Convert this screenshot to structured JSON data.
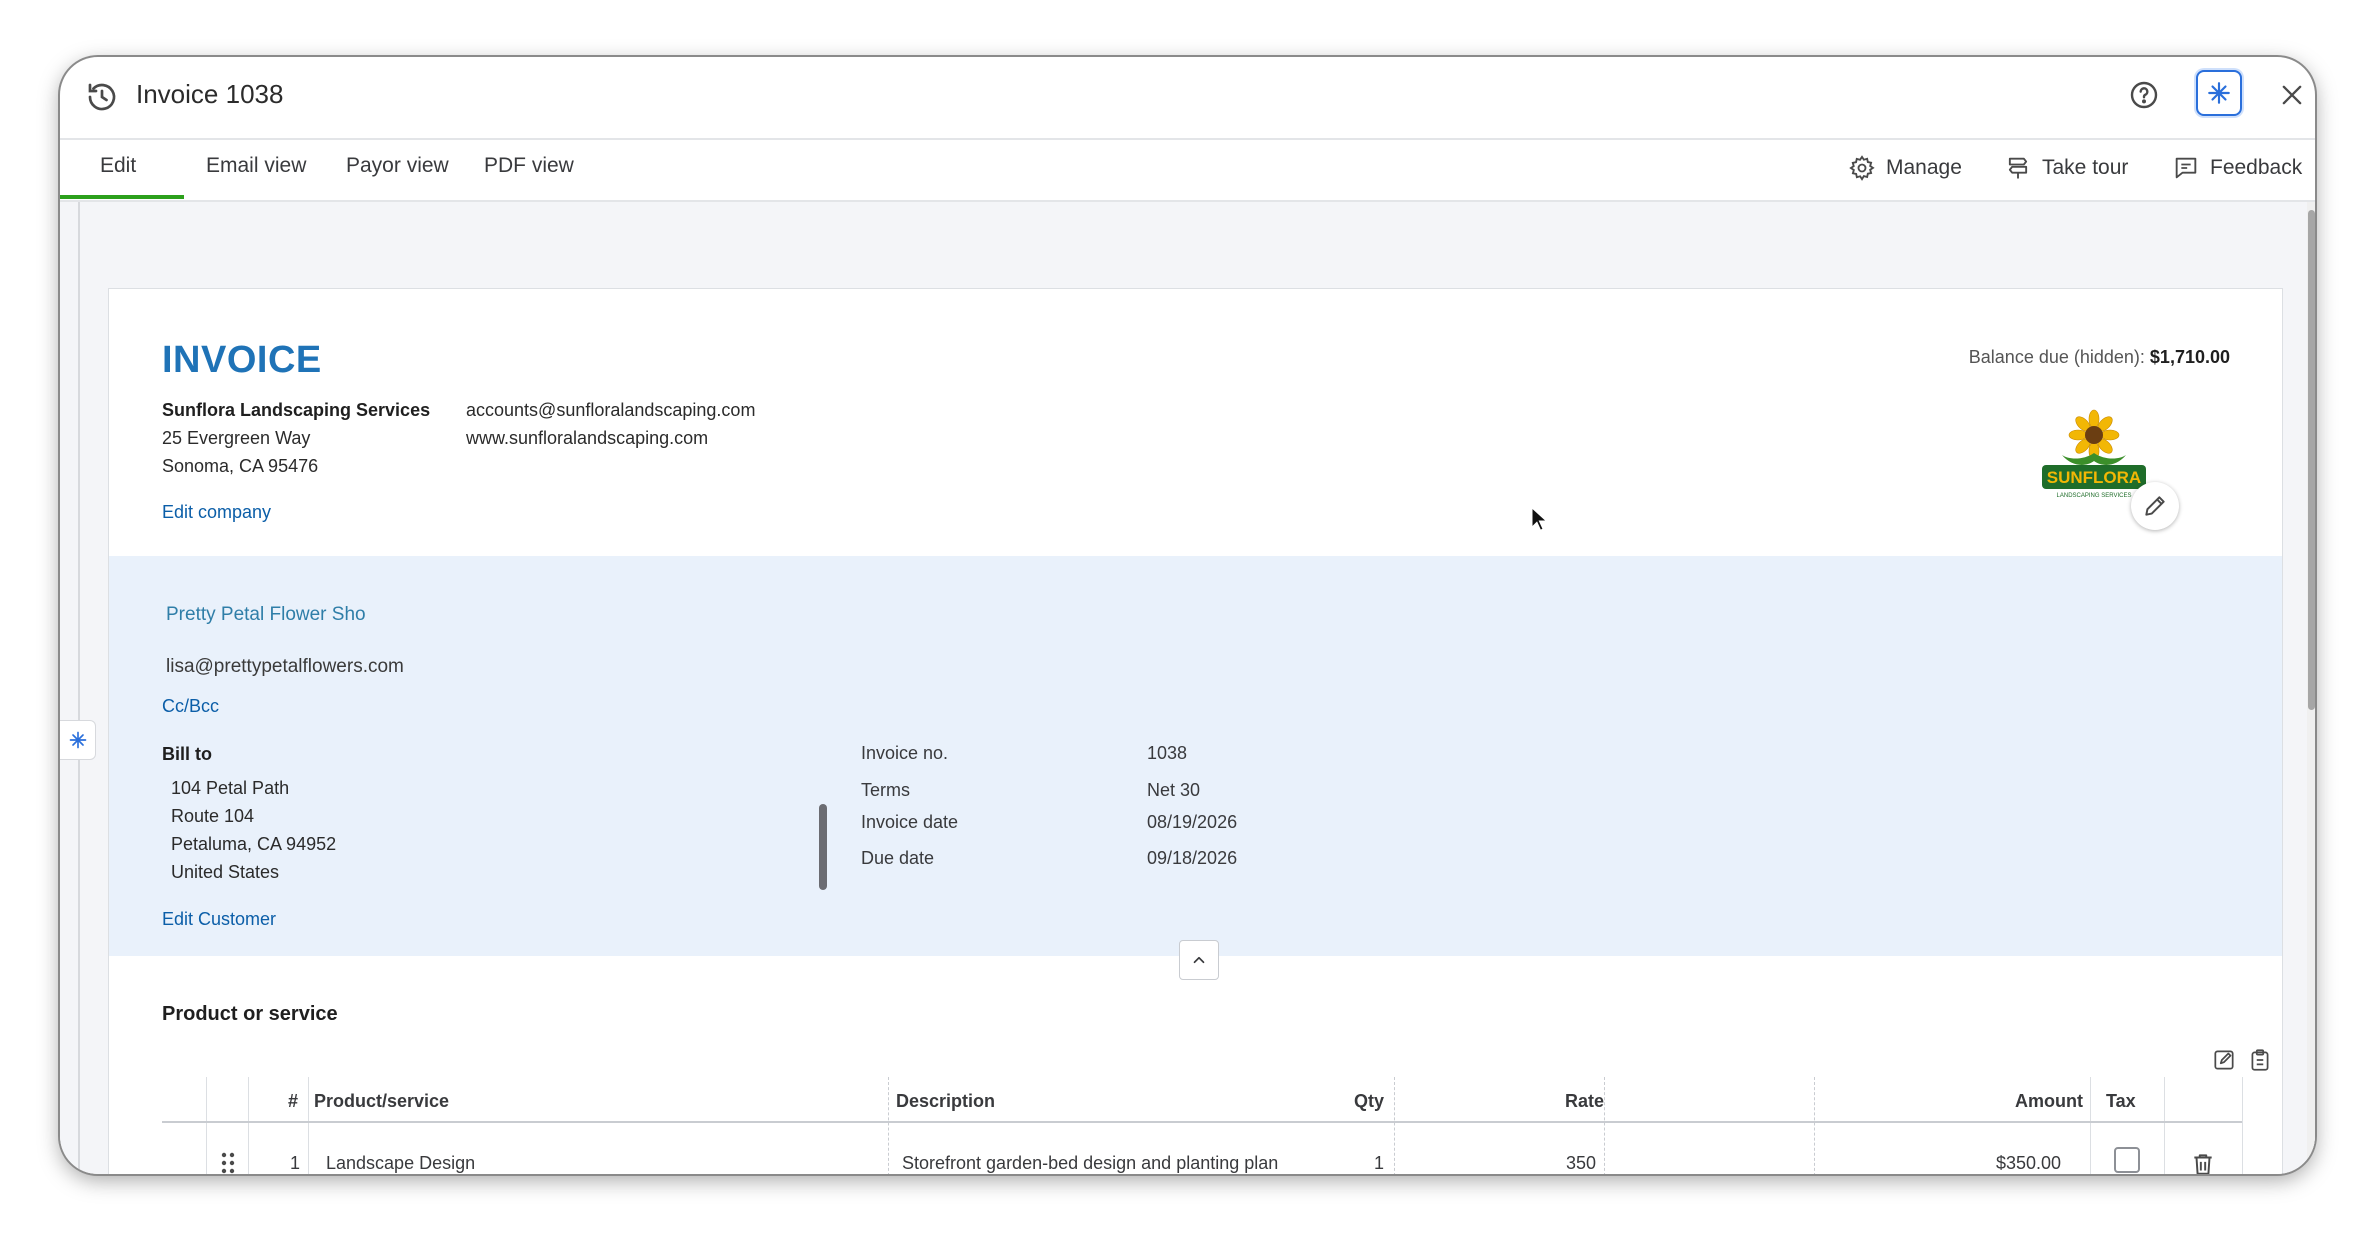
{
  "window": {
    "title": "Invoice 1038"
  },
  "tabs": [
    {
      "label": "Edit"
    },
    {
      "label": "Email view"
    },
    {
      "label": "Payor view"
    },
    {
      "label": "PDF view"
    }
  ],
  "actions": {
    "manage": "Manage",
    "take_tour": "Take tour",
    "feedback": "Feedback"
  },
  "invoice": {
    "heading": "INVOICE",
    "balance_label": "Balance due (hidden):",
    "balance_value": "$1,710.00"
  },
  "company": {
    "name": "Sunflora Landscaping Services",
    "address1": "25 Evergreen Way",
    "address2": "Sonoma, CA 95476",
    "email": "accounts@sunfloralandscaping.com",
    "website": "www.sunfloralandscaping.com",
    "edit_link": "Edit company",
    "logo_text": "SUNFLORA",
    "logo_subtext": "LANDSCAPING SERVICES"
  },
  "customer": {
    "name": "Pretty Petal Flower Sho",
    "email": "lisa@prettypetalflowers.com",
    "ccbcc": "Cc/Bcc",
    "bill_to_label": "Bill to",
    "bill_lines": [
      "104 Petal Path",
      "Route 104",
      "Petaluma, CA  94952",
      "United States"
    ],
    "edit_link": "Edit Customer"
  },
  "meta": [
    {
      "label": "Invoice no.",
      "value": "1038"
    },
    {
      "label": "Terms",
      "value": "Net 30"
    },
    {
      "label": "Invoice date",
      "value": "08/19/2026"
    },
    {
      "label": "Due date",
      "value": "09/18/2026"
    }
  ],
  "products": {
    "title": "Product or service",
    "columns": {
      "num": "#",
      "product": "Product/service",
      "description": "Description",
      "qty": "Qty",
      "rate": "Rate",
      "amount": "Amount",
      "tax": "Tax"
    },
    "rows": [
      {
        "num": "1",
        "product": "Landscape Design",
        "description": "Storefront garden-bed design and planting plan",
        "qty": "1",
        "rate": "350",
        "amount": "$350.00"
      }
    ]
  },
  "colors": {
    "accent_blue": "#1f73b7",
    "link_blue": "#0b5ea8",
    "tab_green": "#2ca01c",
    "panel_blue": "#e9f1fb"
  }
}
